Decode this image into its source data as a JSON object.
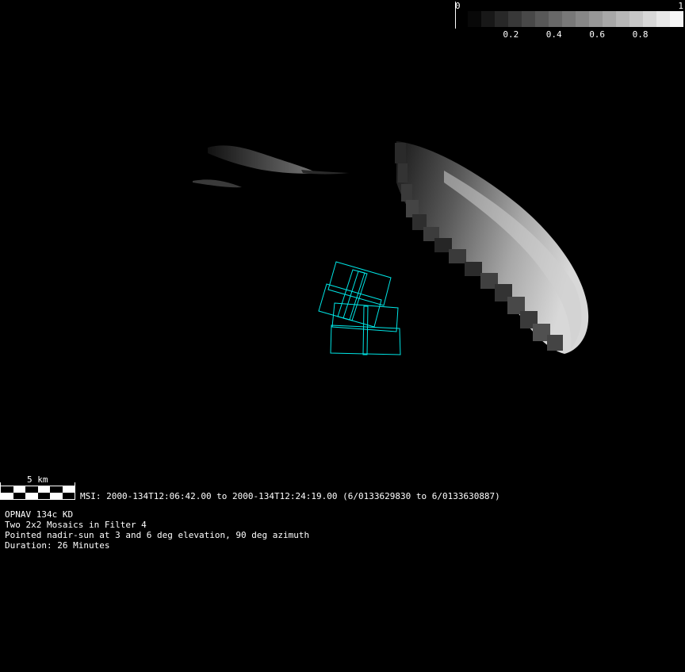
{
  "colorbar": {
    "min_label": "0",
    "max_label": "1",
    "tick_labels": [
      "0.2",
      "0.4",
      "0.6",
      "0.8"
    ],
    "tick_values": [
      0.2,
      0.4,
      0.6,
      0.8
    ],
    "segments": 16,
    "low_color": "#000000",
    "high_color": "#ffffff"
  },
  "scalebar": {
    "label": "5 km"
  },
  "msi": {
    "line": "MSI:  2000-134T12:06:42.00 to 2000-134T12:24:19.00 (6/0133629830 to 6/0133630887)"
  },
  "info": {
    "lines": [
      "OPNAV 134c KD",
      "Two 2x2 Mosaics in Filter 4",
      "Pointed nadir-sun at 3 and 6 deg elevation, 90 deg azimuth",
      "Duration: 26 Minutes"
    ]
  },
  "footprint_color": "#00e5e5",
  "footprints": {
    "count": 2,
    "layout": "2x2"
  }
}
